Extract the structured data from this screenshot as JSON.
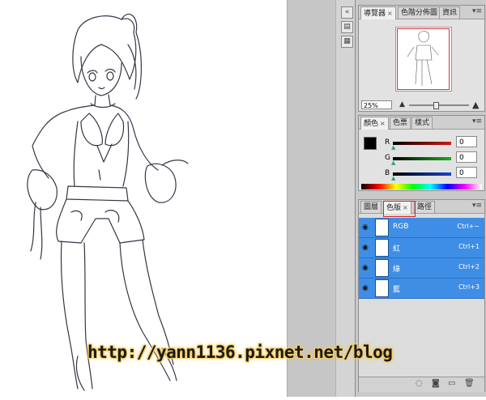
{
  "navigator": {
    "tabs": [
      {
        "label": "導覽器",
        "close": "×"
      },
      {
        "label": "色階分佈圖",
        "close": ""
      },
      {
        "label": "資訊",
        "close": ""
      }
    ],
    "zoom": "25%"
  },
  "color_panel": {
    "tabs": [
      {
        "label": "顏色",
        "close": "×"
      },
      {
        "label": "色票",
        "close": ""
      },
      {
        "label": "樣式",
        "close": ""
      }
    ],
    "channels": [
      {
        "label": "R",
        "value": "0",
        "color": "#d01818"
      },
      {
        "label": "G",
        "value": "0",
        "color": "#18b018"
      },
      {
        "label": "B",
        "value": "0",
        "color": "#1840d0"
      }
    ]
  },
  "channels_panel": {
    "tabs": [
      {
        "label": "圖層",
        "close": ""
      },
      {
        "label": "色版",
        "close": "×"
      },
      {
        "label": "路徑",
        "close": ""
      }
    ],
    "rows": [
      {
        "name": "RGB",
        "shortcut": "Ctrl+~"
      },
      {
        "name": "紅",
        "shortcut": "Ctrl+1"
      },
      {
        "name": "綠",
        "shortcut": "Ctrl+2"
      },
      {
        "name": "藍",
        "shortcut": "Ctrl+3"
      }
    ],
    "row_color": "#3e8ee6"
  },
  "watermark": "http://yann1136.pixnet.net/blog"
}
